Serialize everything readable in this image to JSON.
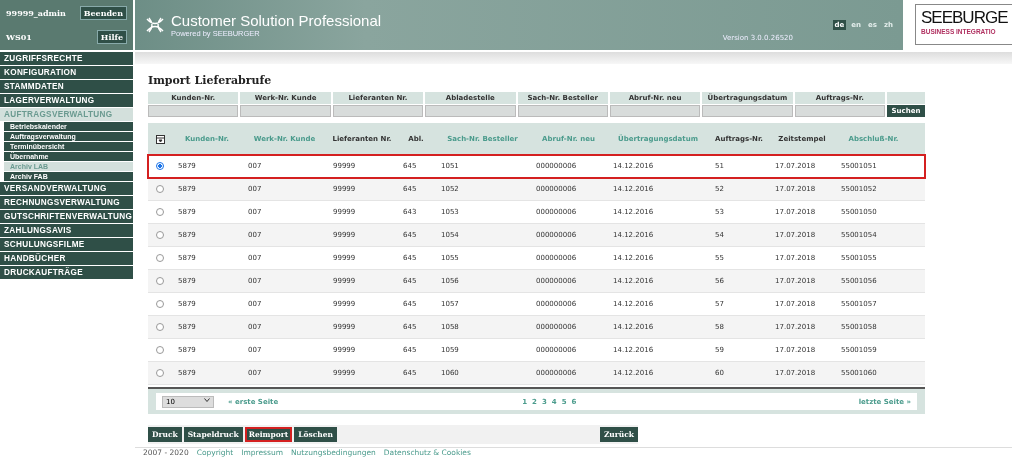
{
  "session": {
    "user": "99999_admin",
    "station": "WS01",
    "buttons": [
      "Beenden",
      "Hilfe"
    ]
  },
  "sidebar": {
    "items": [
      {
        "label": "ZUGRIFFSRECHTE",
        "selected": false
      },
      {
        "label": "KONFIGURATION",
        "selected": false
      },
      {
        "label": "STAMMDATEN",
        "selected": false
      },
      {
        "label": "LAGERVERWALTUNG",
        "selected": false
      },
      {
        "label": "AUFTRAGSVERWALTUNG",
        "selected": true,
        "children": [
          {
            "label": "Betriebskalender",
            "selected": false
          },
          {
            "label": "Auftragsverwaltung",
            "selected": false
          },
          {
            "label": "Terminübersicht",
            "selected": false
          },
          {
            "label": "Übernahme",
            "selected": false
          },
          {
            "label": "Archiv LAB",
            "selected": true
          },
          {
            "label": "Archiv FAB",
            "selected": false
          }
        ]
      },
      {
        "label": "VERSANDVERWALTUNG",
        "selected": false
      },
      {
        "label": "RECHNUNGSVERWALTUNG",
        "selected": false
      },
      {
        "label": "GUTSCHRIFTENVERWALTUNG",
        "selected": false
      },
      {
        "label": "ZAHLUNGSAVIS",
        "selected": false
      },
      {
        "label": "SCHULUNGSFILME",
        "selected": false
      },
      {
        "label": "HANDBÜCHER",
        "selected": false
      },
      {
        "label": "DRUCKAUFTRÄGE",
        "selected": false
      }
    ]
  },
  "header": {
    "title": "Customer Solution Professional",
    "subtitle": "Powered by SEEBURGER",
    "version": "Version 3.0.0.26520",
    "languages": [
      {
        "label": "de",
        "selected": true
      },
      {
        "label": "en",
        "selected": false
      },
      {
        "label": "es",
        "selected": false
      },
      {
        "label": "zh",
        "selected": false
      }
    ],
    "logo": {
      "name": "SEEBURGE",
      "tagline": "BUSINESS INTEGRATIO"
    }
  },
  "page_title": "Import Lieferabrufe",
  "filters": {
    "fields": [
      "Kunden-Nr.",
      "Werk-Nr. Kunde",
      "Lieferanten Nr.",
      "Abladestelle",
      "Sach-Nr. Besteller",
      "Abruf-Nr. neu",
      "Übertragungsdatum",
      "Auftrags-Nr."
    ],
    "search_button": "Suchen"
  },
  "table": {
    "columns": [
      {
        "label": "Kunden-Nr.",
        "sortable": true
      },
      {
        "label": "Werk-Nr. Kunde",
        "sortable": true
      },
      {
        "label": "Lieferanten Nr.",
        "sortable": false
      },
      {
        "label": "Abl.",
        "sortable": false
      },
      {
        "label": "Sach-Nr. Besteller",
        "sortable": true
      },
      {
        "label": "Abruf-Nr. neu",
        "sortable": true
      },
      {
        "label": "Übertragungsdatum",
        "sortable": true
      },
      {
        "label": "Auftrags-Nr.",
        "sortable": false
      },
      {
        "label": "Zeitstempel",
        "sortable": false
      },
      {
        "label": "Abschluß-Nr.",
        "sortable": true
      }
    ],
    "rows": [
      {
        "selected": true,
        "highlighted": true,
        "cells": [
          "5879",
          "007",
          "99999",
          "645",
          "1051",
          "000000006",
          "14.12.2016",
          "51",
          "17.07.2018",
          "55001051"
        ]
      },
      {
        "selected": false,
        "highlighted": false,
        "cells": [
          "5879",
          "007",
          "99999",
          "645",
          "1052",
          "000000006",
          "14.12.2016",
          "52",
          "17.07.2018",
          "55001052"
        ]
      },
      {
        "selected": false,
        "highlighted": false,
        "cells": [
          "5879",
          "007",
          "99999",
          "643",
          "1053",
          "000000006",
          "14.12.2016",
          "53",
          "17.07.2018",
          "55001050"
        ]
      },
      {
        "selected": false,
        "highlighted": false,
        "cells": [
          "5879",
          "007",
          "99999",
          "645",
          "1054",
          "000000006",
          "14.12.2016",
          "54",
          "17.07.2018",
          "55001054"
        ]
      },
      {
        "selected": false,
        "highlighted": false,
        "cells": [
          "5879",
          "007",
          "99999",
          "645",
          "1055",
          "000000006",
          "14.12.2016",
          "55",
          "17.07.2018",
          "55001055"
        ]
      },
      {
        "selected": false,
        "highlighted": false,
        "cells": [
          "5879",
          "007",
          "99999",
          "645",
          "1056",
          "000000006",
          "14.12.2016",
          "56",
          "17.07.2018",
          "55001056"
        ]
      },
      {
        "selected": false,
        "highlighted": false,
        "cells": [
          "5879",
          "007",
          "99999",
          "645",
          "1057",
          "000000006",
          "14.12.2016",
          "57",
          "17.07.2018",
          "55001057"
        ]
      },
      {
        "selected": false,
        "highlighted": false,
        "cells": [
          "5879",
          "007",
          "99999",
          "645",
          "1058",
          "000000006",
          "14.12.2016",
          "58",
          "17.07.2018",
          "55001058"
        ]
      },
      {
        "selected": false,
        "highlighted": false,
        "cells": [
          "5879",
          "007",
          "99999",
          "645",
          "1059",
          "000000006",
          "14.12.2016",
          "59",
          "17.07.2018",
          "55001059"
        ]
      },
      {
        "selected": false,
        "highlighted": false,
        "cells": [
          "5879",
          "007",
          "99999",
          "645",
          "1060",
          "000000006",
          "14.12.2016",
          "60",
          "17.07.2018",
          "55001060"
        ]
      }
    ]
  },
  "pager": {
    "page_size": "10",
    "first": "« erste Seite",
    "pages": [
      "1",
      "2",
      "3",
      "4",
      "5",
      "6"
    ],
    "last": "letzte Seite »"
  },
  "actions": [
    {
      "label": "Druck",
      "highlighted": false
    },
    {
      "label": "Stapeldruck",
      "highlighted": false
    },
    {
      "label": "Reimport",
      "highlighted": true
    },
    {
      "label": "Löschen",
      "highlighted": false
    }
  ],
  "back_button": "Zurück",
  "footer": [
    "2007 - 2020",
    "Copyright",
    "Impressum",
    "Nutzungsbedingungen",
    "Datenschutz & Cookies"
  ]
}
